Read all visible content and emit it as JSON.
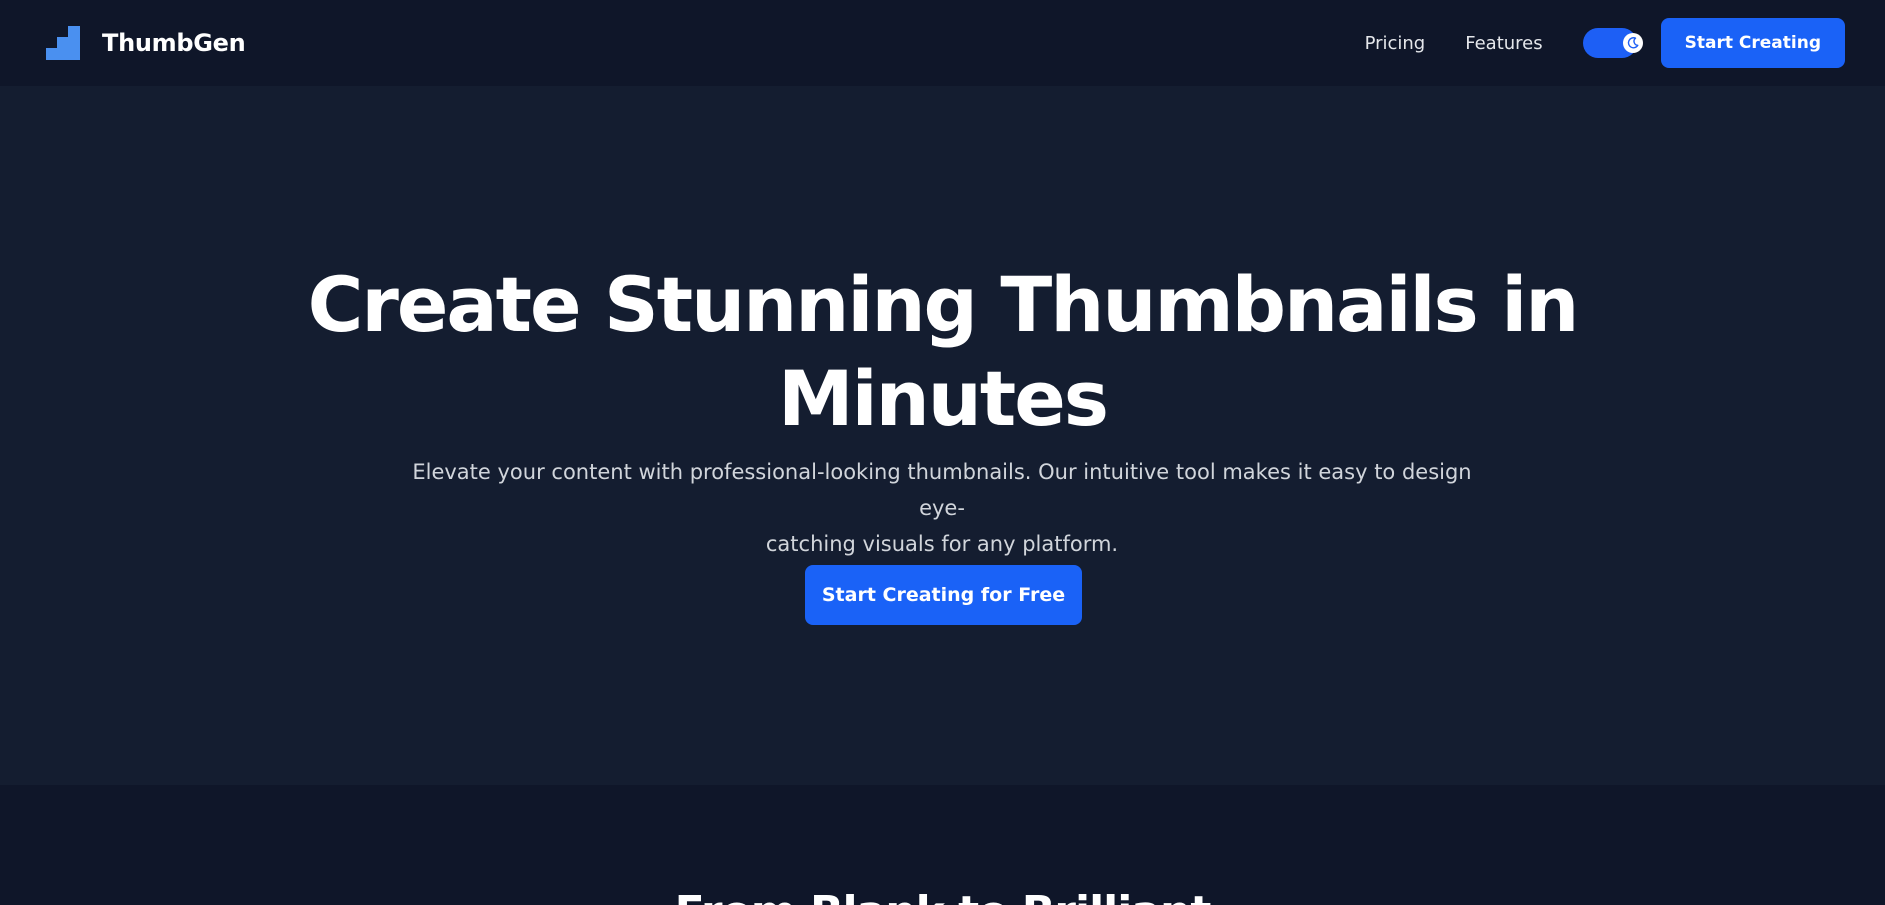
{
  "header": {
    "brand": "ThumbGen",
    "nav": [
      "Pricing",
      "Features"
    ],
    "cta_label": "Start Creating",
    "theme_toggle_state": "dark",
    "icons": {
      "logo": "stairs-logo-icon",
      "theme": "moon-icon"
    }
  },
  "hero": {
    "title_line1": "Create Stunning Thumbnails in",
    "title_line2": "Minutes",
    "subtitle_line1": "Elevate your content with professional-looking thumbnails. Our intuitive tool makes it easy to design eye-",
    "subtitle_line2": "catching visuals for any platform.",
    "cta_label": "Start Creating for Free"
  },
  "next_section": {
    "title": "From Blank to Brilliant"
  },
  "colors": {
    "accent": "#1a62f7",
    "logo": "#4a90f0",
    "nav_bg": "#0f1629",
    "hero_bg": "#141d30"
  }
}
